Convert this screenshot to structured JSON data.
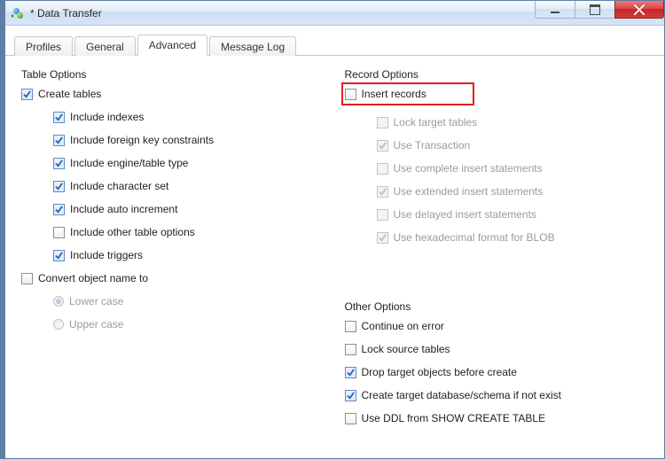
{
  "window": {
    "title": "* Data Transfer"
  },
  "tabs": {
    "profiles": "Profiles",
    "general": "General",
    "advanced": "Advanced",
    "messagelog": "Message Log",
    "active": "advanced"
  },
  "table_options": {
    "title": "Table Options",
    "create_tables": "Create tables",
    "include_indexes": "Include indexes",
    "include_fk": "Include foreign key constraints",
    "include_engine": "Include engine/table type",
    "include_charset": "Include character set",
    "include_autoinc": "Include auto increment",
    "include_other": "Include other table options",
    "include_triggers": "Include triggers",
    "convert_name": "Convert object name to",
    "lower_case": "Lower case",
    "upper_case": "Upper case"
  },
  "record_options": {
    "title": "Record Options",
    "insert_records": "Insert records",
    "lock_target": "Lock target tables",
    "use_transaction": "Use Transaction",
    "complete_insert": "Use complete insert statements",
    "extended_insert": "Use extended insert statements",
    "delayed_insert": "Use delayed insert statements",
    "hex_blob": "Use hexadecimal format for BLOB"
  },
  "other_options": {
    "title": "Other Options",
    "continue_error": "Continue on error",
    "lock_source": "Lock source tables",
    "drop_target": "Drop target objects before create",
    "create_db": "Create target database/schema if not exist",
    "use_ddl": "Use DDL from SHOW CREATE TABLE"
  }
}
